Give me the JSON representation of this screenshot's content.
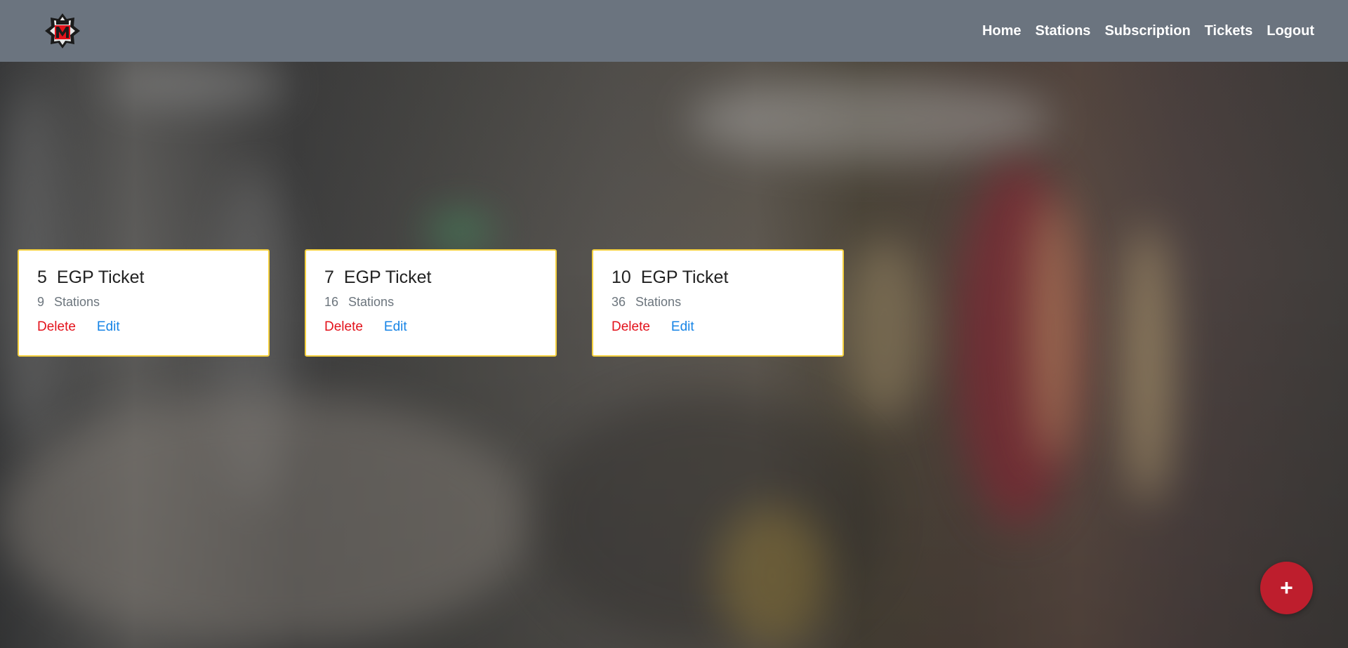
{
  "nav": {
    "home": "Home",
    "stations": "Stations",
    "subscription": "Subscription",
    "tickets": "Tickets",
    "logout": "Logout"
  },
  "tickets": [
    {
      "price": "5",
      "currency_label": "EGP Ticket",
      "stations": "9",
      "stations_label": "Stations",
      "delete_label": "Delete",
      "edit_label": "Edit"
    },
    {
      "price": "7",
      "currency_label": "EGP Ticket",
      "stations": "16",
      "stations_label": "Stations",
      "delete_label": "Delete",
      "edit_label": "Edit"
    },
    {
      "price": "10",
      "currency_label": "EGP Ticket",
      "stations": "36",
      "stations_label": "Stations",
      "delete_label": "Delete",
      "edit_label": "Edit"
    }
  ],
  "fab": {
    "icon": "plus-icon",
    "label": "+"
  },
  "colors": {
    "topbar": "#6b747f",
    "card_border": "#f4d03f",
    "delete": "#e3121b",
    "edit": "#1684e6",
    "fab": "#be1e2d"
  }
}
